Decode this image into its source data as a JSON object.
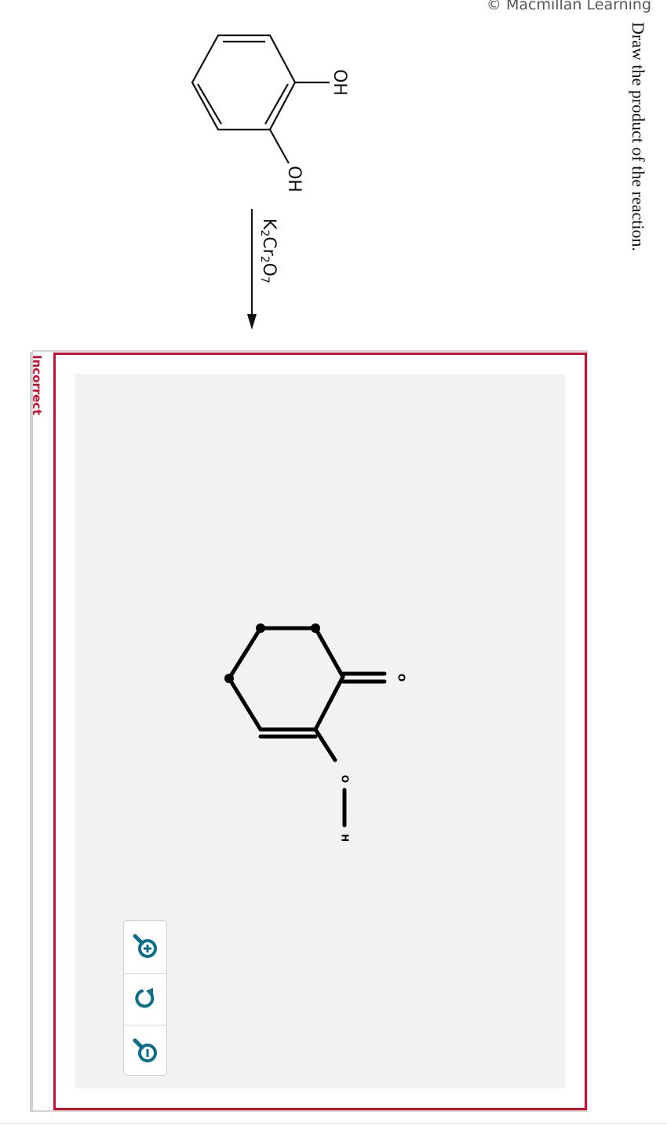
{
  "header": {
    "copyright": "© Macmillan Learning"
  },
  "question": {
    "prompt": "Draw the product of the reaction."
  },
  "reactant": {
    "oh_top": "OH",
    "oh_bottom": "OH"
  },
  "reagent": {
    "k": "K",
    "k_sub": "2",
    "cr": "Cr",
    "cr_sub": "2",
    "o": "O",
    "o_sub": "7"
  },
  "answer": {
    "status": "Incorrect",
    "atom_carbonyl_o": "O",
    "atom_hydroxyl_o": "O",
    "atom_hydroxyl_h": "H"
  },
  "toolbar": {
    "zoom_in_icon": "zoom-in-icon",
    "reset_icon": "reset-icon",
    "zoom_out_icon": "zoom-out-icon",
    "icon_color": "#0b6e8a"
  },
  "colors": {
    "incorrect": "#c8102e",
    "canvas_bg": "#f2f2f2"
  }
}
